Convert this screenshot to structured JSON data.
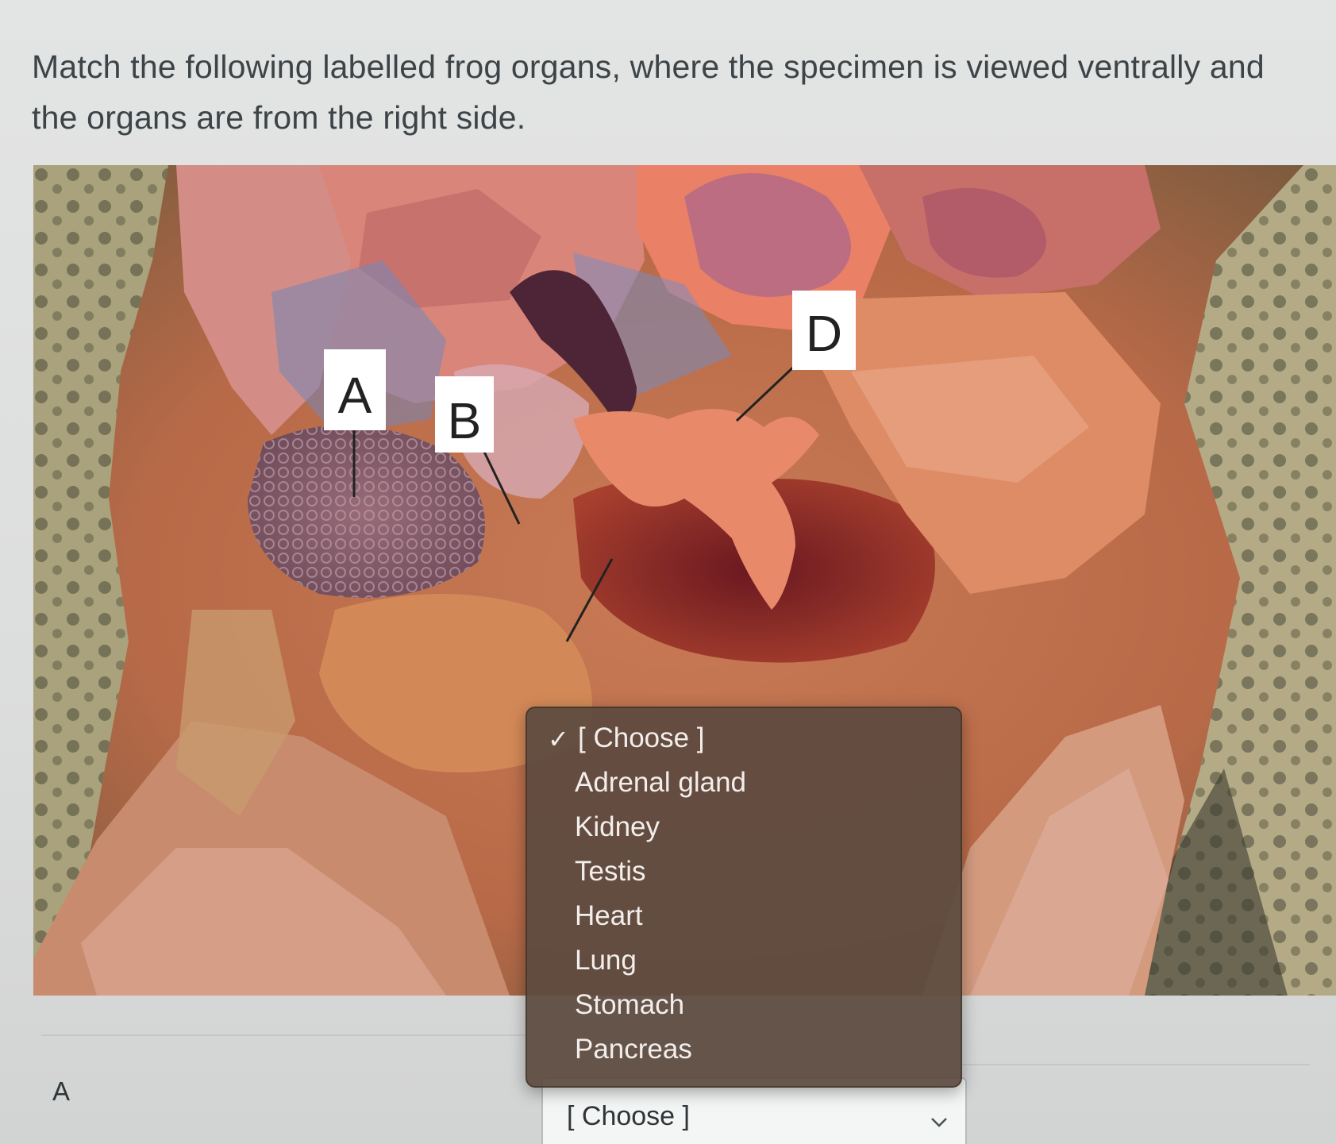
{
  "question": {
    "text": "Match the following labelled frog organs, where the specimen is viewed ventrally and the organs are from the right side."
  },
  "figure": {
    "labels": [
      "A",
      "B",
      "D"
    ]
  },
  "dropdown": {
    "check_icon": "checkmark-icon",
    "options": [
      "[ Choose ]",
      "Adrenal gland",
      "Kidney",
      "Testis",
      "Heart",
      "Lung",
      "Stomach",
      "Pancreas"
    ],
    "selected_index": 0
  },
  "answer_row": {
    "label": "A",
    "select_value": "[ Choose ]"
  }
}
